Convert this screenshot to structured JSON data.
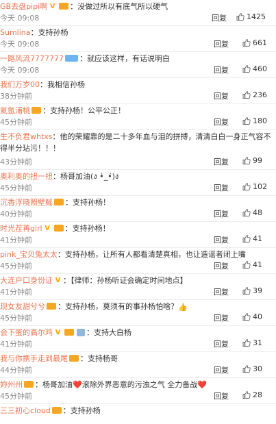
{
  "reply_label": "回复",
  "comments": [
    {
      "user": "GB去盘pipi啊",
      "badges": [
        "v",
        "vip"
      ],
      "text": "没做过所以有底气所以硬气",
      "time": "今天 09:08",
      "likes": "1425"
    },
    {
      "user": "Sumlina",
      "badges": [],
      "text": "支持孙杨",
      "time": "今天 09:08",
      "likes": "661"
    },
    {
      "user": "一路风流7777777",
      "badges": [
        "member"
      ],
      "text": "就应该这样，有话说明白",
      "time": "今天 09:08",
      "likes": "460"
    },
    {
      "user": "我们万岁00",
      "badges": [],
      "text": "我相信孙杨",
      "time": "38分钟前",
      "likes": "236"
    },
    {
      "user": "氦氩浦桃",
      "badges": [
        "vip"
      ],
      "text": "支持孙杨！公平公正！",
      "time": "45分钟前",
      "likes": "180"
    },
    {
      "user": "生不负君whtxs",
      "badges": [],
      "text": "他的荣耀靠的是二十多年血与泪的拼搏，清清白白一身正气容不得半分玷污！！！",
      "time": "43分钟前",
      "likes": "99"
    },
    {
      "user": "奥利奥的扭一扭",
      "badges": [],
      "text": "杨哥加油(ง •̀_•́)ง",
      "time": "45分钟前",
      "likes": "102"
    },
    {
      "user": "沉香浮晓照壁鳐",
      "badges": [
        "vip"
      ],
      "text": "支持孙杨！",
      "time": "40分钟前",
      "likes": "48"
    },
    {
      "user": "时光茬苒girl",
      "badges": [
        "v",
        "vip"
      ],
      "text": "支持孙杨！",
      "time": "41分钟前",
      "likes": "41"
    },
    {
      "user": "pink_宝贝兔太太",
      "badges": [],
      "text": "支持孙杨，让所有人都看清楚真相，也让造谣者闭上嘴",
      "time": "45分钟前",
      "likes": "41"
    },
    {
      "user": "大连户口身份证",
      "badges": [
        "v"
      ],
      "text": "【律师：孙杨听证会确定时间地点】",
      "time": "41分钟前",
      "likes": "39"
    },
    {
      "user": "现女友甜兮兮",
      "badges": [
        "vip"
      ],
      "text": "支持孙杨，莫须有的事孙杨怕啥？",
      "text_emoji": "👍",
      "time": "45分钟前",
      "likes": "40"
    },
    {
      "user": "会下蛋的高尔鸡",
      "badges": [
        "v",
        "vip",
        "level"
      ],
      "text": "支持大白杨",
      "time": "41分钟前",
      "likes": "31"
    },
    {
      "user": "我与你携手走到最尾",
      "badges": [
        "vip"
      ],
      "text": "支持杨哥",
      "time": "44分钟前",
      "likes": "30"
    },
    {
      "user": "妳州州",
      "badges": [
        "vip"
      ],
      "text": "杨哥加油❤️滚除外界恶意的污浊之气 全力备战❤️",
      "time": "45分钟前",
      "likes": "28"
    },
    {
      "user": "三三初心cloud",
      "badges": [
        "vip"
      ],
      "text": "支持孙杨",
      "time": "",
      "likes": ""
    }
  ]
}
